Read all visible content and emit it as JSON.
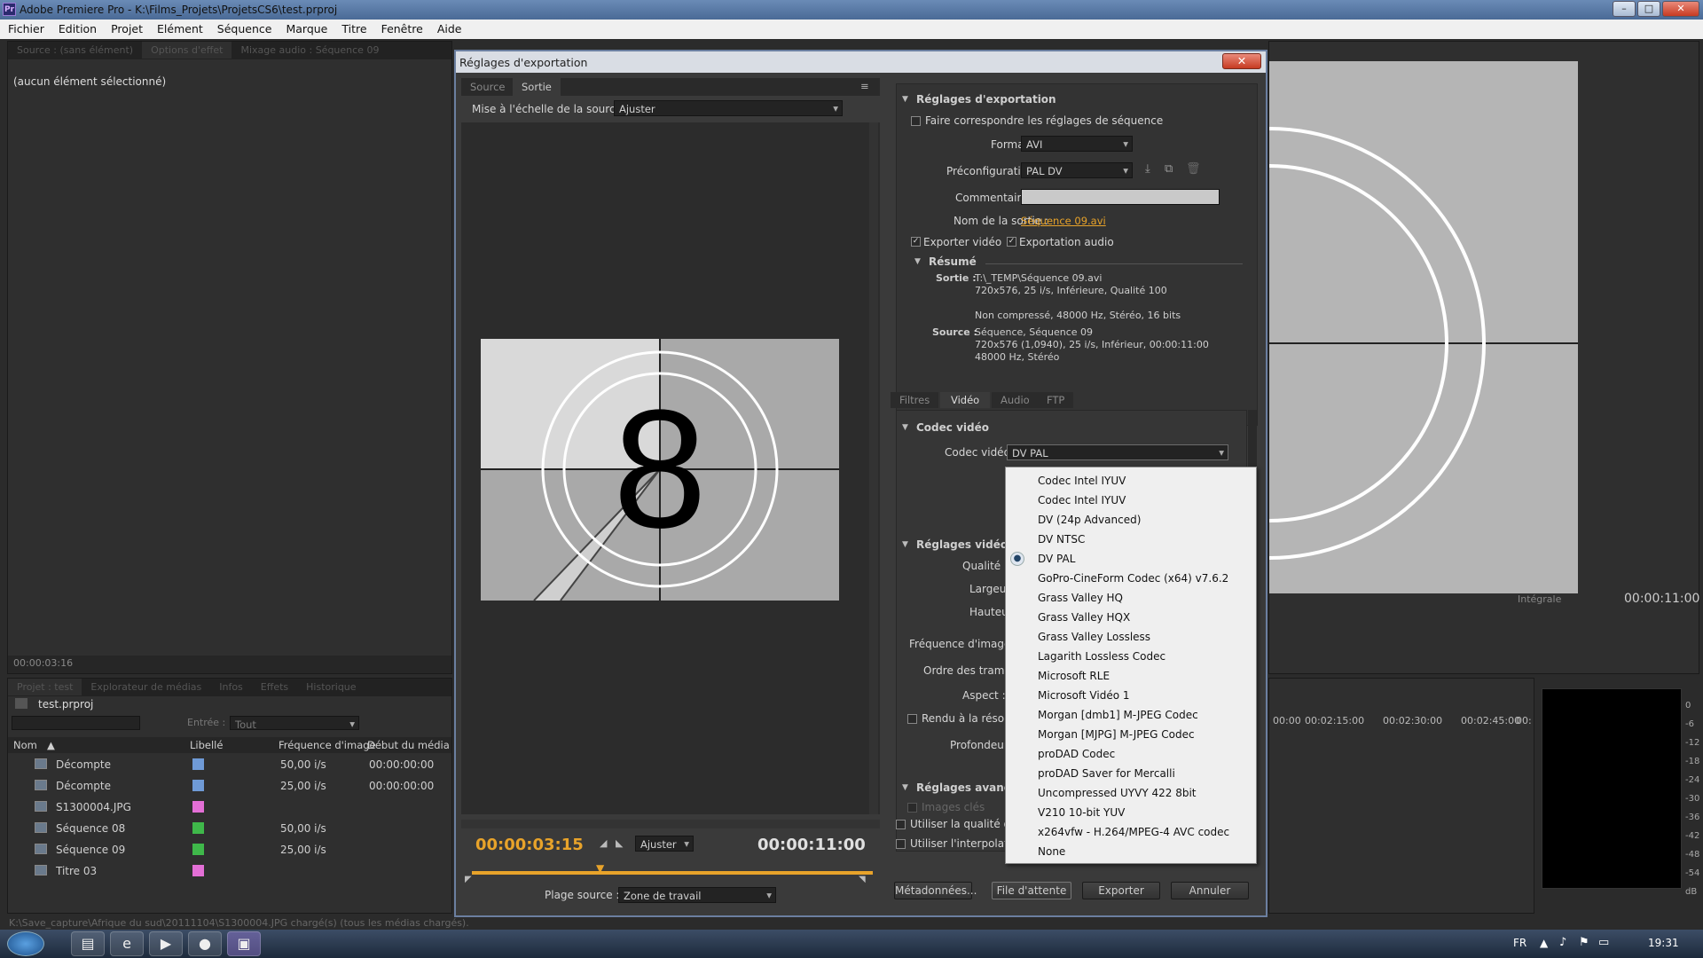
{
  "app": {
    "title": "Adobe Premiere Pro - K:\\Films_Projets\\ProjetsCS6\\test.prproj",
    "icon_text": "Pr"
  },
  "window_buttons": {
    "minimize": "–",
    "maximize": "□",
    "close": "✕"
  },
  "menu": [
    "Fichier",
    "Edition",
    "Projet",
    "Elément",
    "Séquence",
    "Marque",
    "Titre",
    "Fenêtre",
    "Aide"
  ],
  "left_panel": {
    "tabs": [
      "Source : (sans élément)",
      "Options d'effet",
      "Mixage audio : Séquence 09"
    ],
    "selection_text": "(aucun élément sélectionné)",
    "timecode": "00:00:03:16"
  },
  "project_panel": {
    "tabs": [
      "Projet : test",
      "Explorateur de médias",
      "Infos",
      "Effets",
      "Historique"
    ],
    "project_name": "test.prproj",
    "entry_label": "Entrée :",
    "entry_value": "Tout",
    "columns": [
      "Nom",
      "Libellé",
      "Fréquence d'image",
      "Début du média"
    ],
    "rows": [
      {
        "name": "Décompte",
        "color": "#6f9ad6",
        "fps": "50,00 i/s",
        "start": "00:00:00:00"
      },
      {
        "name": "Décompte",
        "color": "#6f9ad6",
        "fps": "25,00 i/s",
        "start": "00:00:00:00"
      },
      {
        "name": "S1300004.JPG",
        "color": "#e36fd6",
        "fps": "",
        "start": ""
      },
      {
        "name": "Séquence 08",
        "color": "#3fb84a",
        "fps": "50,00 i/s",
        "start": ""
      },
      {
        "name": "Séquence 09",
        "color": "#3fb84a",
        "fps": "25,00 i/s",
        "start": ""
      },
      {
        "name": "Titre 03",
        "color": "#e36fd6",
        "fps": "",
        "start": ""
      }
    ]
  },
  "status_bar": "K:\\Save_capture\\Afrique du sud\\20111104\\S1300004.JPG chargé(s) (tous les médias chargés).",
  "program_monitor": {
    "fit": "Intégrale",
    "duration": "00:00:11:00",
    "ruler": [
      "00:00",
      "00:02:15:00",
      "00:02:30:00",
      "00:02:45:00",
      "00:"
    ],
    "meter_labels": [
      "0",
      "-6",
      "-12",
      "-18",
      "-24",
      "-30",
      "-36",
      "-42",
      "-48",
      "-54",
      "dB"
    ]
  },
  "dialog": {
    "title": "Réglages d'exportation",
    "close": "✕",
    "tabs": [
      "Source",
      "Sortie"
    ],
    "scale_label": "Mise à l'échelle de la source :",
    "scale_value": "Ajuster",
    "preview_digit": "8",
    "current_time": "00:00:03:15",
    "fit": "Ajuster",
    "duration": "00:00:11:00",
    "range_label": "Plage source :",
    "range_value": "Zone de travail",
    "export_settings": {
      "header": "Réglages d'exportation",
      "match_label": "Faire correspondre les réglages de séquence",
      "format_label": "Format :",
      "format_value": "AVI",
      "preset_label": "Préconfiguration :",
      "preset_value": "PAL DV",
      "comments_label": "Commentaires :",
      "output_label": "Nom de la sortie :",
      "output_value": "Séquence 09.avi",
      "export_video": "Exporter vidéo",
      "export_audio": "Exportation audio",
      "summary_header": "Résumé",
      "out_label": "Sortie :",
      "out_lines": [
        "T:\\_TEMP\\Séquence 09.avi",
        "720x576, 25 i/s, Inférieure, Qualité  100",
        "",
        "Non compressé, 48000 Hz, Stéréo, 16 bits"
      ],
      "src_label": "Source :",
      "src_lines": [
        "Séquence, Séquence 09",
        "720x576 (1,0940), 25  i/s, Inférieur, 00:00:11:00",
        "48000 Hz, Stéréo"
      ]
    },
    "settings_tabs": [
      "Filtres",
      "Vidéo",
      "Audio",
      "FTP"
    ],
    "codec_header": "Codec vidéo",
    "codec_label": "Codec vidéo :",
    "codec_value": "DV PAL",
    "basic_header": "Réglages vidéo de",
    "quality_label": "Qualité :",
    "width_label": "Largeur :",
    "height_label": "Hauteur :",
    "fps_label": "Fréquence d'images :",
    "field_label": "Ordre des trames :",
    "aspect_label": "Aspect :",
    "render_label": "Rendu à la résolutio",
    "depth_label": "Profondeur :",
    "advanced_header": "Réglages avancés",
    "keyframes_label": "Images clés",
    "max_quality": "Utiliser la qualité de r",
    "interp": "Utiliser l'interpolation",
    "btn_meta": "Métadonnées...",
    "btn_queue": "File d'attente",
    "btn_export": "Exporter",
    "btn_cancel": "Annuler"
  },
  "codec_options": [
    "Codec Intel IYUV",
    "Codec Intel IYUV",
    "DV (24p Advanced)",
    "DV NTSC",
    "DV PAL",
    "GoPro-CineForm Codec (x64) v7.6.2",
    "Grass Valley HQ",
    "Grass Valley HQX",
    "Grass Valley Lossless",
    "Lagarith Lossless Codec",
    "Microsoft RLE",
    "Microsoft Vidéo 1",
    "Morgan [dmb1] M-JPEG Codec",
    "Morgan [MJPG] M-JPEG Codec",
    "proDAD Codec",
    "proDAD Saver for Mercalli",
    "Uncompressed UYVY 422 8bit",
    "V210 10-bit YUV",
    "x264vfw - H.264/MPEG-4 AVC codec",
    "None"
  ],
  "selected_codec": "DV PAL",
  "taskbar": {
    "lang": "FR",
    "clock": "19:31"
  }
}
